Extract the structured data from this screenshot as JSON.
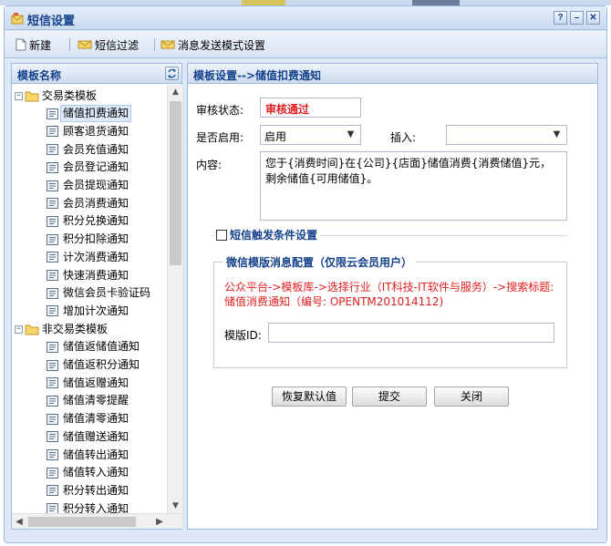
{
  "window": {
    "title": "短信设置",
    "controls": [
      "?",
      "–",
      "✕"
    ]
  },
  "toolbar": {
    "new_label": "新建",
    "filter_label": "短信过滤",
    "mode_label": "消息发送模式设置"
  },
  "template_list": {
    "header": "模板名称",
    "groups": [
      {
        "label": "交易类模板",
        "items": [
          "储值扣费通知",
          "顾客退货通知",
          "会员充值通知",
          "会员登记通知",
          "会员提现通知",
          "会员消费通知",
          "积分兑换通知",
          "积分扣除通知",
          "计次消费通知",
          "快速消费通知",
          "微信会员卡验证码",
          "增加计次通知"
        ]
      },
      {
        "label": "非交易类模板",
        "items": [
          "储值返储值通知",
          "储值返积分通知",
          "储值返赠通知",
          "储值清零提醒",
          "储值清零通知",
          "储值赠送通知",
          "储值转出通知",
          "储值转入通知",
          "积分转出通知",
          "积分转入通知"
        ]
      }
    ],
    "selected": "储值扣费通知"
  },
  "form": {
    "header": "模板设置-->储值扣费通知",
    "status_label": "审核状态:",
    "status_value": "审核通过",
    "enabled_label": "是否启用:",
    "enabled_value": "启用",
    "insert_label": "插入:",
    "insert_value": "",
    "content_label": "内容:",
    "content_value": "您于{消费时间}在{公司}{店面}储值消费{消费储值}元，剩余储值{可用储值}。",
    "trigger_label": "短信触发条件设置",
    "trigger_checked": false,
    "wechat_legend": "微信模版消息配置（仅限云会员用户）",
    "wechat_note": "公众平台->模板库->选择行业（IT科技-IT软件与服务）->搜索标题:储值消费通知（编号: OPENTM201014112)",
    "template_id_label": "模版ID:",
    "template_id_value": ""
  },
  "buttons": {
    "restore": "恢复默认值",
    "submit": "提交",
    "close": "关闭"
  },
  "colors": {
    "accent": "#15428b",
    "alert": "#e02020",
    "border": "#99bbe8"
  }
}
